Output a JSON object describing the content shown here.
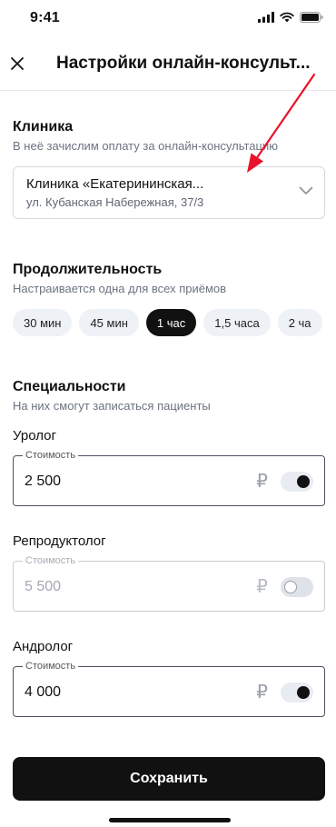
{
  "status": {
    "time": "9:41"
  },
  "nav": {
    "title": "Настройки онлайн-консульт..."
  },
  "clinic": {
    "title": "Клиника",
    "subtitle": "В неё зачислим оплату за онлайн-консультацию",
    "name": "Клиника «Екатерининская...",
    "address": "ул. Кубанская Набережная, 37/3"
  },
  "duration": {
    "title": "Продолжительность",
    "subtitle": "Настраивается одна для всех приёмов",
    "options": [
      "30 мин",
      "45 мин",
      "1 час",
      "1,5 часа",
      "2 ча"
    ],
    "selected": "1 час"
  },
  "specialties": {
    "title": "Специальности",
    "subtitle": "На них смогут записаться пациенты",
    "items": [
      {
        "name": "Уролог",
        "legend": "Стоимость",
        "price": "2 500",
        "currency": "₽",
        "enabled": true
      },
      {
        "name": "Репродуктолог",
        "legend": "Стоимость",
        "price": "5 500",
        "currency": "₽",
        "enabled": false
      },
      {
        "name": "Андролог",
        "legend": "Стоимость",
        "price": "4 000",
        "currency": "₽",
        "enabled": true
      }
    ]
  },
  "save_label": "Сохранить",
  "colors": {
    "accent": "#111111",
    "chip_bg": "#eef1f6",
    "annotation_arrow": "#e8132a"
  }
}
